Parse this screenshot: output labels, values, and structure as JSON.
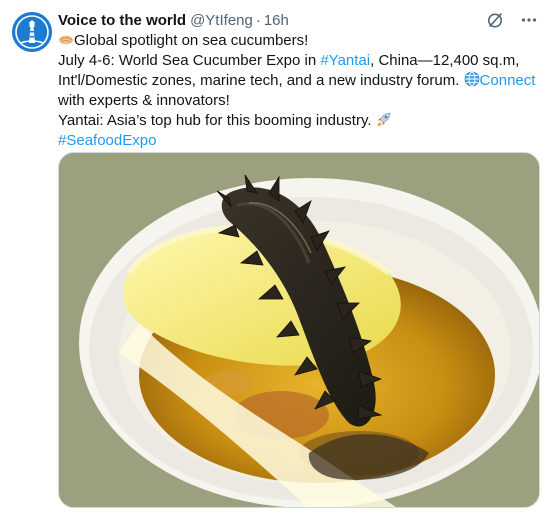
{
  "tweet": {
    "display_name": "Voice to the world",
    "handle": "@YtIfeng",
    "separator": "·",
    "time": "16h",
    "line1_text": "Global spotlight on sea cucumbers!",
    "line2_prefix": "July 4-6: World Sea Cucumber Expo in ",
    "hashtag_yantai": "#Yantai",
    "line2_suffix": ", China—12,400 sq.m,",
    "line3_text": "Int'l/Domestic zones, marine tech, and a new industry forum. ",
    "line3_link": "Connect",
    "line4_text": "with experts & innovators!",
    "line5_text": "Yantai: Asia’s top hub for this booming industry. ",
    "hashtag_seafood": "#SeafoodExpo"
  },
  "icons": {
    "avatar": "lighthouse-logo",
    "grok": "slash-circle-icon",
    "more": "more-horizontal-icon",
    "line1_emoji": "sea-cucumber-emoji",
    "line3_emoji": "globe-emoji",
    "line5_emoji": "rocket-emoji"
  },
  "colors": {
    "link": "#1d9bf0",
    "secondary_text": "#536471",
    "avatar_bg": "#1d7bd1"
  },
  "media": {
    "subject": "sea cucumber on spoon in yellow broth"
  }
}
